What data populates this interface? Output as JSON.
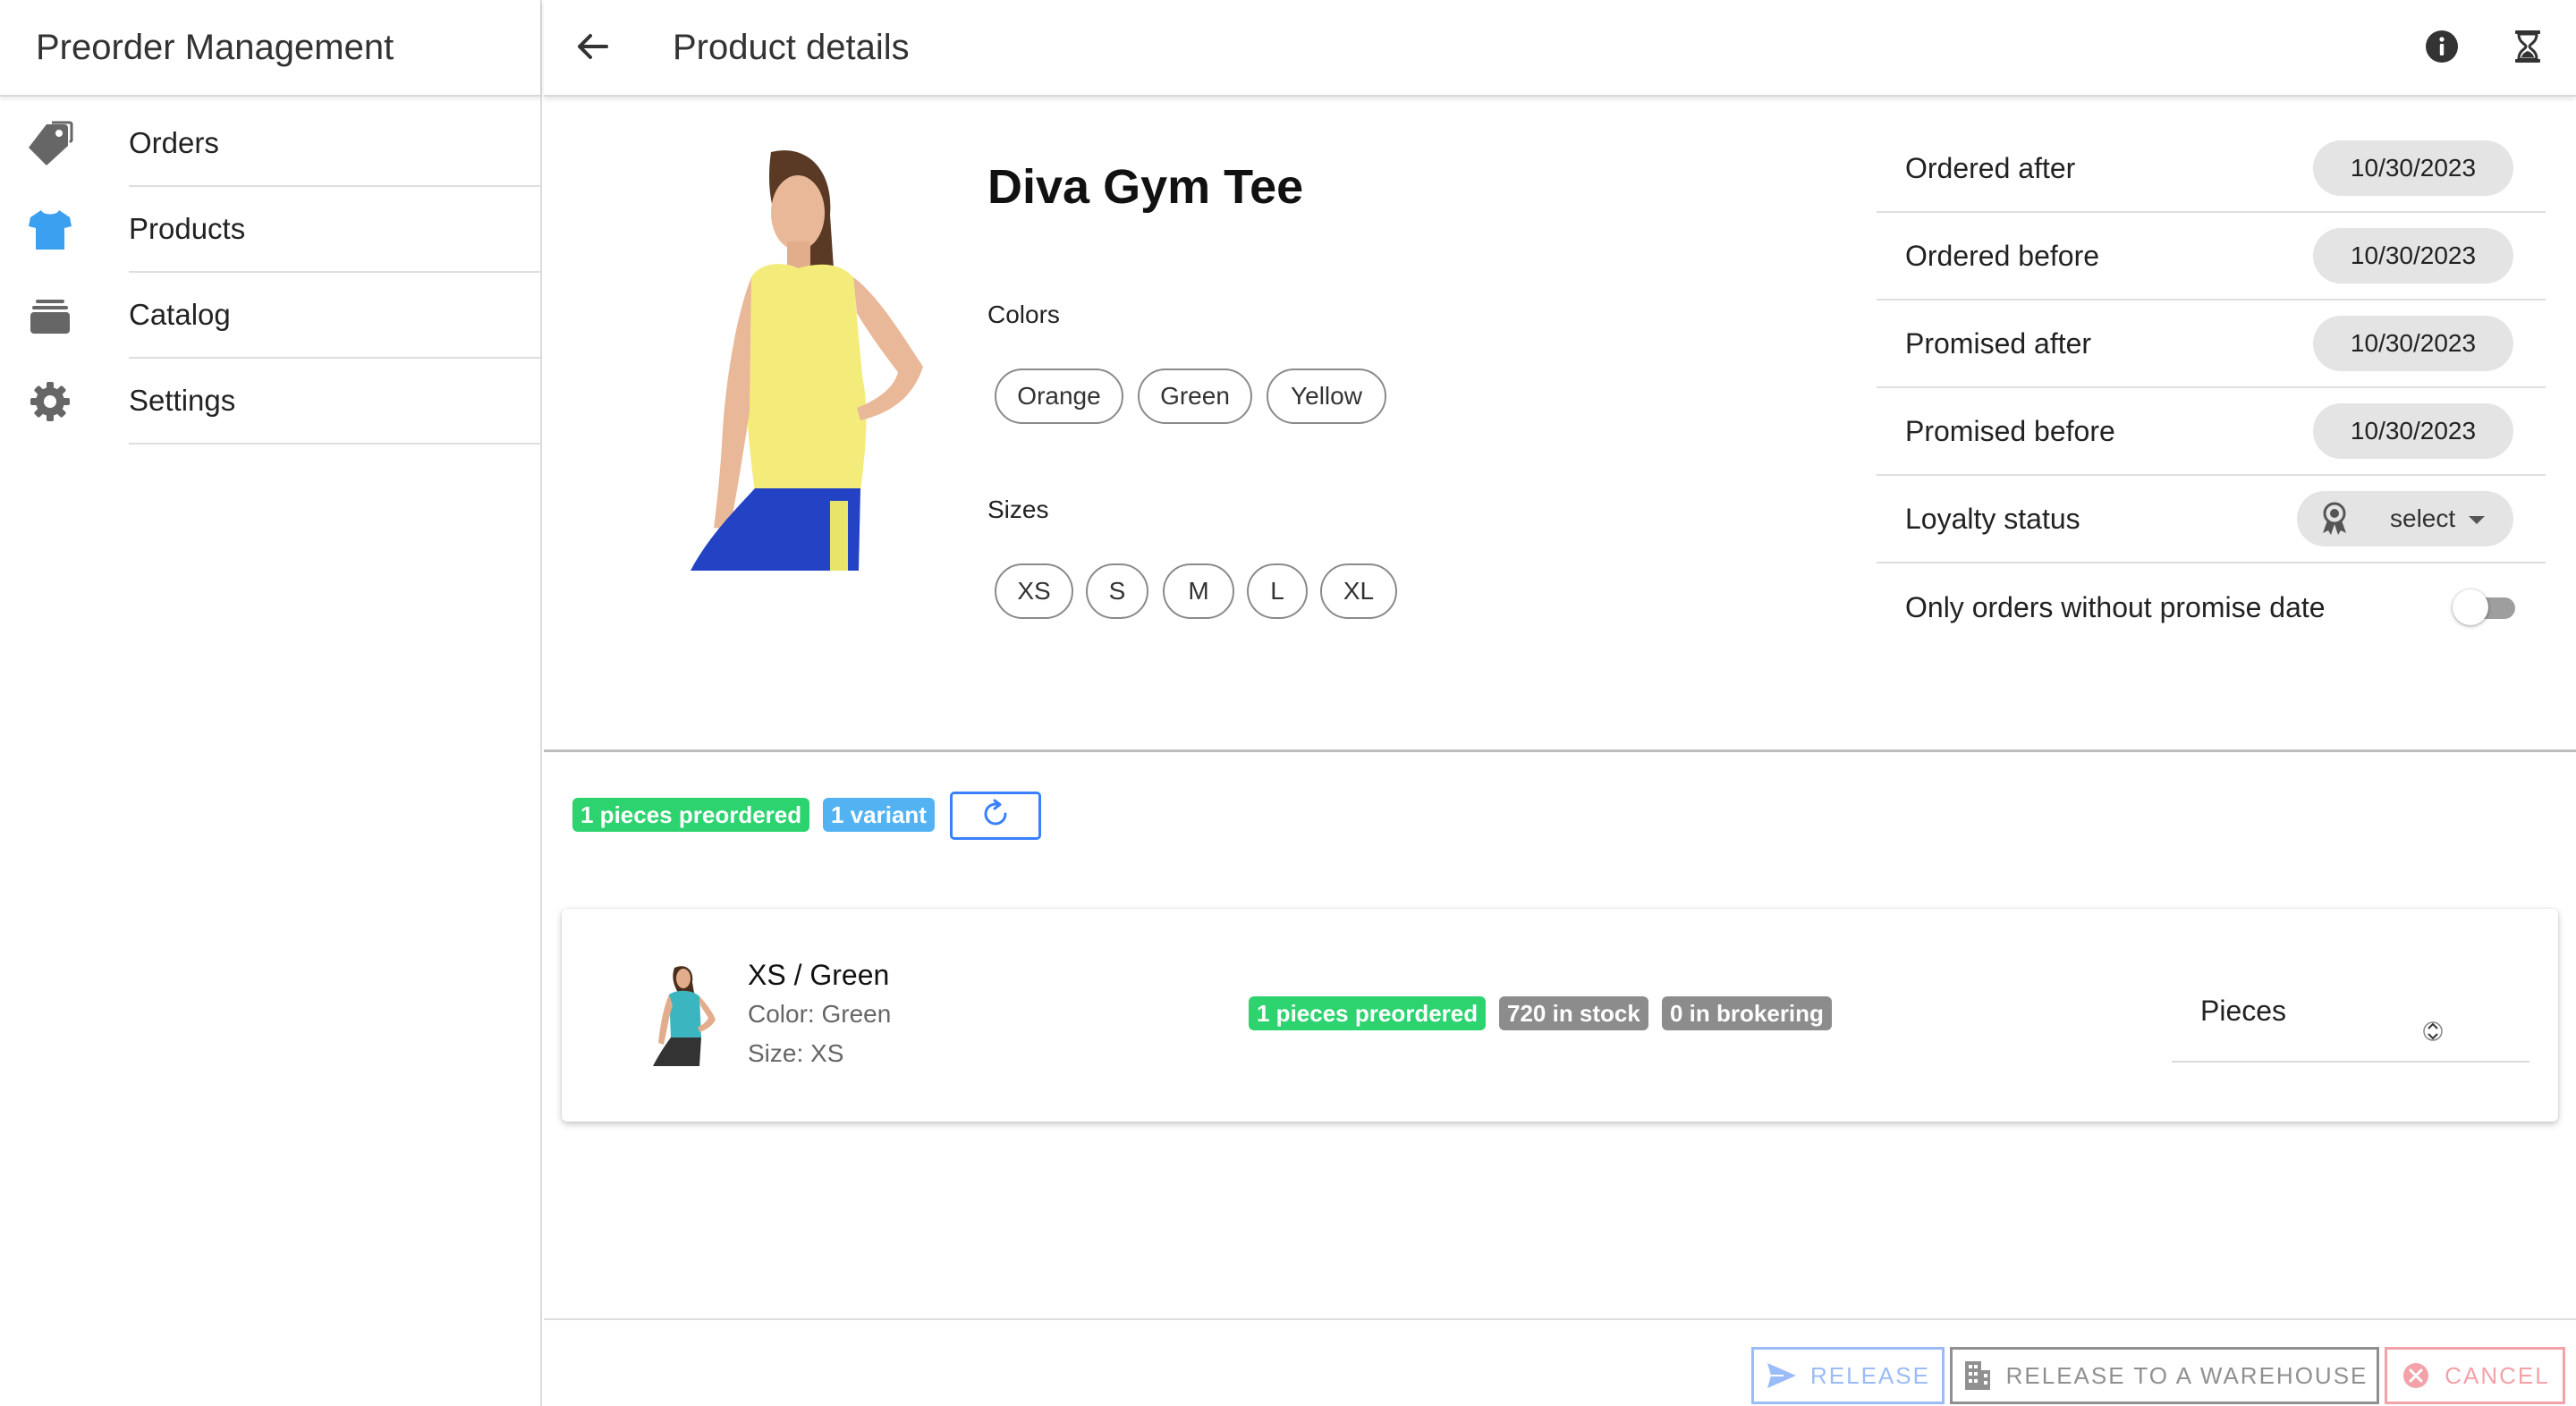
{
  "app": {
    "title": "Preorder Management"
  },
  "sidebar": {
    "items": [
      {
        "label": "Orders",
        "icon": "pricetags-icon",
        "active": false
      },
      {
        "label": "Products",
        "icon": "shirt-icon",
        "active": true
      },
      {
        "label": "Catalog",
        "icon": "albums-icon",
        "active": false
      },
      {
        "label": "Settings",
        "icon": "settings-icon",
        "active": false
      }
    ]
  },
  "header": {
    "title": "Product details",
    "back_icon": "arrow-back-icon",
    "info_icon": "information-icon",
    "job_icon": "hourglass-icon"
  },
  "product": {
    "name": "Diva Gym Tee",
    "colors_label": "Colors",
    "colors": [
      "Orange",
      "Green",
      "Yellow"
    ],
    "sizes_label": "Sizes",
    "sizes": [
      "XS",
      "S",
      "M",
      "L",
      "XL"
    ]
  },
  "filters": {
    "ordered_after": {
      "label": "Ordered after",
      "value": "10/30/2023"
    },
    "ordered_before": {
      "label": "Ordered before",
      "value": "10/30/2023"
    },
    "promised_after": {
      "label": "Promised after",
      "value": "10/30/2023"
    },
    "promised_before": {
      "label": "Promised before",
      "value": "10/30/2023"
    },
    "loyalty": {
      "label": "Loyalty status",
      "value": "select",
      "icon": "ribbon-icon"
    },
    "no_promise": {
      "label": "Only orders without promise date",
      "checked": false
    }
  },
  "summary": {
    "preordered": "1 pieces preordered",
    "variants": "1 variant",
    "refresh_icon": "refresh-icon"
  },
  "variant": {
    "title": "XS / Green",
    "color": "Color: Green",
    "size": "Size: XS",
    "preordered": "1 pieces preordered",
    "in_stock": "720 in stock",
    "brokering": "0 in brokering",
    "pieces_label": "Pieces"
  },
  "footer": {
    "release": "RELEASE",
    "release_warehouse": "RELEASE TO A WAREHOUSE",
    "cancel": "CANCEL"
  },
  "colors": {
    "primary": "#3880ff",
    "success": "#2dd36f",
    "info": "#52b2f2",
    "medium": "#8c8c8c",
    "danger": "#eb445a",
    "active_icon": "#3ba0f0",
    "icon_grey": "#666666"
  }
}
